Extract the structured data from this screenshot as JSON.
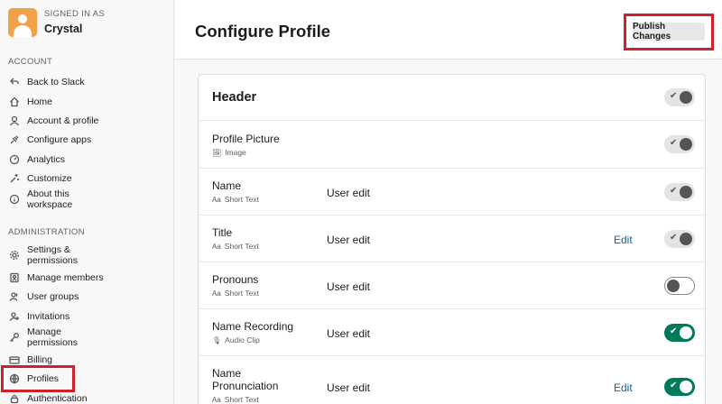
{
  "user": {
    "signed_in_label": "SIGNED IN AS",
    "name": "Crystal"
  },
  "sidebar": {
    "account_title": "ACCOUNT",
    "account_items": [
      {
        "label": "Back to Slack",
        "icon": "back-arrow-icon"
      },
      {
        "label": "Home",
        "icon": "home-icon"
      },
      {
        "label": "Account & profile",
        "icon": "person-icon"
      },
      {
        "label": "Configure apps",
        "icon": "plug-icon"
      },
      {
        "label": "Analytics",
        "icon": "gauge-icon"
      },
      {
        "label": "Customize",
        "icon": "sparkle-icon"
      },
      {
        "label": "About this workspace",
        "icon": "info-icon"
      }
    ],
    "admin_title": "ADMINISTRATION",
    "admin_items": [
      {
        "label": "Settings & permissions",
        "icon": "gear-icon"
      },
      {
        "label": "Manage members",
        "icon": "member-list-icon"
      },
      {
        "label": "User groups",
        "icon": "group-icon"
      },
      {
        "label": "Invitations",
        "icon": "add-person-icon"
      },
      {
        "label": "Manage permissions",
        "icon": "key-icon"
      },
      {
        "label": "Billing",
        "icon": "card-icon"
      },
      {
        "label": "Profiles",
        "icon": "globe-icon",
        "highlighted": true
      },
      {
        "label": "Authentication",
        "icon": "lock-icon"
      }
    ]
  },
  "header": {
    "title": "Configure Profile",
    "publish_label": "Publish Changes"
  },
  "card": {
    "section_title": "Header",
    "section_toggle": "on",
    "rows": [
      {
        "title": "Profile Picture",
        "type": "Image",
        "type_icon": "image-icon",
        "edit": "",
        "link": "",
        "toggle": "on"
      },
      {
        "title": "Name",
        "type": "Short Text",
        "type_icon": "text-aa-icon",
        "edit": "User edit",
        "link": "",
        "toggle": "on"
      },
      {
        "title": "Title",
        "type": "Short Text",
        "type_icon": "text-aa-icon",
        "edit": "User edit",
        "link": "Edit",
        "toggle": "on"
      },
      {
        "title": "Pronouns",
        "type": "Short Text",
        "type_icon": "text-aa-icon",
        "edit": "User edit",
        "link": "",
        "toggle": "off"
      },
      {
        "title": "Name Recording",
        "type": "Audio Clip",
        "type_icon": "microphone-icon",
        "edit": "User edit",
        "link": "",
        "toggle": "green"
      },
      {
        "title": "Name Pronunciation",
        "type": "Short Text",
        "type_icon": "text-aa-icon",
        "edit": "User edit",
        "link": "Edit",
        "toggle": "green"
      }
    ]
  },
  "colors": {
    "accent_green": "#007a5a",
    "link_blue": "#1264a3",
    "highlight_red": "#d0202a",
    "avatar_orange": "#f0a14a"
  }
}
